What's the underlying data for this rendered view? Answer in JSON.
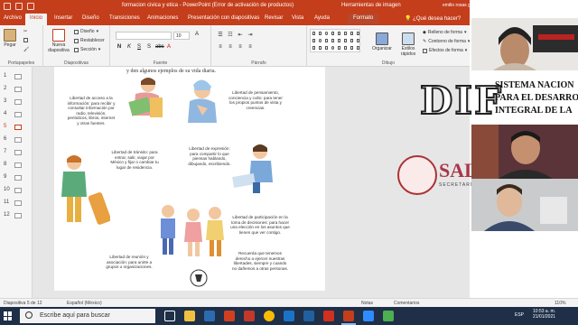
{
  "window": {
    "title": "formacion civica y etica  -  PowerPoint (Error de activación de productos)",
    "context_tab_group": "Herramientas de imagen",
    "user": "emilio rosas garcia"
  },
  "tabs": [
    {
      "label": "Archivo"
    },
    {
      "label": "Inicio"
    },
    {
      "label": "Insertar"
    },
    {
      "label": "Diseño"
    },
    {
      "label": "Transiciones"
    },
    {
      "label": "Animaciones"
    },
    {
      "label": "Presentación con diapositivas"
    },
    {
      "label": "Revisar"
    },
    {
      "label": "Vista"
    },
    {
      "label": "Ayuda"
    },
    {
      "label": "Formato"
    }
  ],
  "help_search": "¿Qué desea hacer?",
  "ribbon": {
    "clipboard": {
      "paste": "Pegar",
      "label": "Portapapeles"
    },
    "slides": {
      "new_slide": "Nueva diapositiva",
      "layout": "Diseño",
      "reset": "Restablecer",
      "section": "Sección",
      "label": "Diapositivas"
    },
    "font": {
      "size": "10",
      "label": "Fuente"
    },
    "paragraph": {
      "label": "Párrafo"
    },
    "drawing": {
      "arrange": "Organizar",
      "styles": "Estilos rápidos",
      "fill": "Relleno de forma",
      "outline": "Contorno de forma",
      "effects": "Efectos de forma",
      "label": "Dibujo"
    }
  },
  "slide_thumbnails": [
    "1",
    "2",
    "3",
    "4",
    "5",
    "6",
    "7",
    "8",
    "9",
    "10",
    "11",
    "12"
  ],
  "active_slide": 5,
  "slide": {
    "intro": "y den algunos ejemplos de su vida diaria.",
    "blocks": [
      {
        "text": "Libertad de acceso a la información: para recibir y consultar información por radio, televisión, periódicos, libros, internet y otras fuentes."
      },
      {
        "text": "Libertad de pensamiento, conciencia y culto: para tener los propios puntos de vista y creencias."
      },
      {
        "text": "Libertad de tránsito: para entrar, salir, viajar por México y fijar o cambiar tu lugar de residencia."
      },
      {
        "text": "Libertad de expresión: para compartir lo que piensas hablando, dibujando, escribiendo."
      },
      {
        "text": "Libertad de participación en la toma de decisiones: para hacer una elección en los asuntos que tienen que ver contigo."
      },
      {
        "text": "Libertad de reunión y asociación: para unirte a grupos u organizaciones."
      },
      {
        "text": "Recuerda que tenemos derecho a ejercer nuestras libertades, siempre y cuando no dañemos a otras personas."
      }
    ]
  },
  "video": {
    "dif_letters": "DIF",
    "dif_lines": [
      "SISTEMA NACION",
      "PARA EL DESARRO",
      "INTEGRAL DE LA"
    ],
    "sa_text": "SAL",
    "secretaria": "SECRETARÍA"
  },
  "status": {
    "slide_of": "Diapositiva 5 de 12",
    "language": "Español (México)",
    "notes": "Notas",
    "comments": "Comentarios",
    "zoom": "110%"
  },
  "taskbar": {
    "search_placeholder": "Escribe aquí para buscar",
    "time": "10:53 a. m.",
    "date": "21/01/2021",
    "lang": "ESP"
  },
  "colors": {
    "accent": "#c43e1c",
    "taskbar": "#1e2f47"
  }
}
